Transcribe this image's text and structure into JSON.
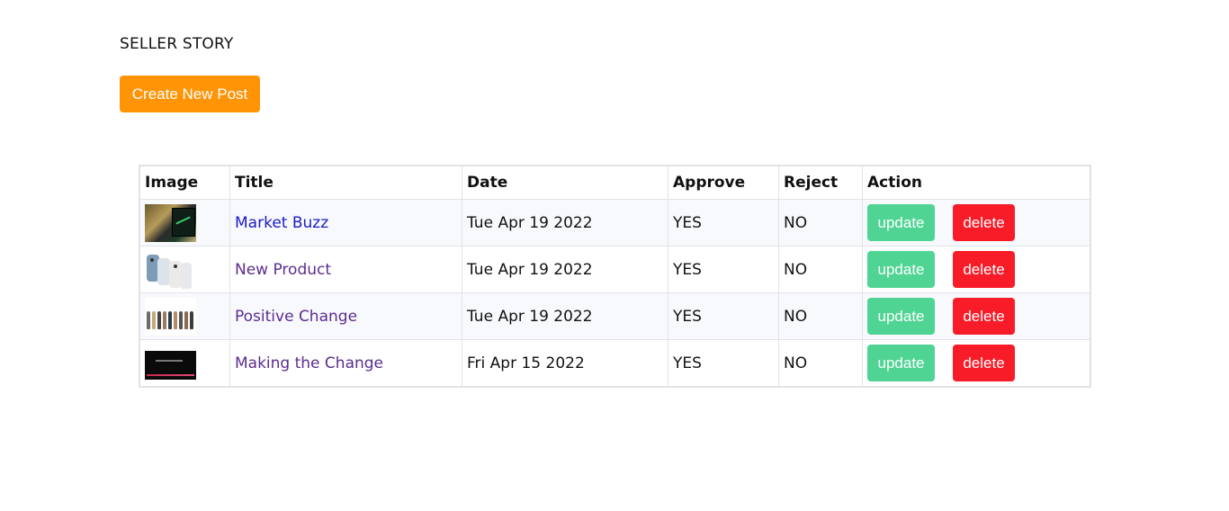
{
  "page": {
    "heading": "SELLER STORY",
    "create_button_label": "Create New Post"
  },
  "table": {
    "headers": {
      "image": "Image",
      "title": "Title",
      "date": "Date",
      "approve": "Approve",
      "reject": "Reject",
      "action": "Action"
    },
    "rows": [
      {
        "title": "Market Buzz",
        "date": "Tue Apr 19 2022",
        "approve": "YES",
        "reject": "NO",
        "update_label": "update",
        "delete_label": "delete",
        "image_icon": "market-buzz-thumbnail"
      },
      {
        "title": "New Product",
        "date": "Tue Apr 19 2022",
        "approve": "YES",
        "reject": "NO",
        "update_label": "update",
        "delete_label": "delete",
        "image_icon": "new-product-thumbnail"
      },
      {
        "title": "Positive Change",
        "date": "Tue Apr 19 2022",
        "approve": "YES",
        "reject": "NO",
        "update_label": "update",
        "delete_label": "delete",
        "image_icon": "positive-change-thumbnail"
      },
      {
        "title": "Making the Change",
        "date": "Fri Apr 15 2022",
        "approve": "YES",
        "reject": "NO",
        "update_label": "update",
        "delete_label": "delete",
        "image_icon": "making-the-change-thumbnail"
      }
    ]
  },
  "colors": {
    "create_button": "#ff9407",
    "update_button": "#4fd494",
    "delete_button": "#f71c27",
    "link": "#1a1ac9",
    "link_visited": "#5b2d8e"
  }
}
